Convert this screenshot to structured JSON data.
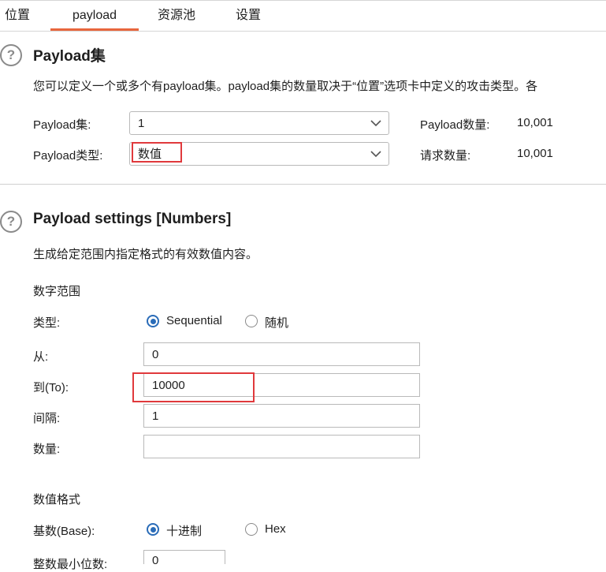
{
  "tabs": [
    {
      "label": "位置"
    },
    {
      "label": "payload"
    },
    {
      "label": "资源池"
    },
    {
      "label": "设置"
    }
  ],
  "payload_sets": {
    "title": "Payload集",
    "description": "您可以定义一个或多个有payload集。payload集的数量取决于“位置”选项卡中定义的攻击类型。各",
    "set_label": "Payload集:",
    "set_value": "1",
    "type_label": "Payload类型:",
    "type_value": "数值",
    "count_label": "Payload数量:",
    "count_value": "10,001",
    "request_label": "请求数量:",
    "request_value": "10,001"
  },
  "payload_settings": {
    "title": "Payload settings [Numbers]",
    "description": "生成给定范围内指定格式的有效数值内容。",
    "range_heading": "数字范围",
    "type_label": "类型:",
    "sequential_label": "Sequential",
    "random_label": "随机",
    "from_label": "从:",
    "from_value": "0",
    "to_label": "到(To):",
    "to_value": "10000",
    "step_label": "间隔:",
    "step_value": "1",
    "how_many_label": "数量:",
    "how_many_value": "",
    "format_heading": "数值格式",
    "base_label": "基数(Base):",
    "decimal_label": "十进制",
    "hex_label": "Hex",
    "min_int_digits_label": "整数最小位数:",
    "min_int_digits_value": "0"
  },
  "colors": {
    "tab_underline": "#e8663d",
    "highlight_box": "#e0393c",
    "radio_selected": "#2a6cb8"
  }
}
